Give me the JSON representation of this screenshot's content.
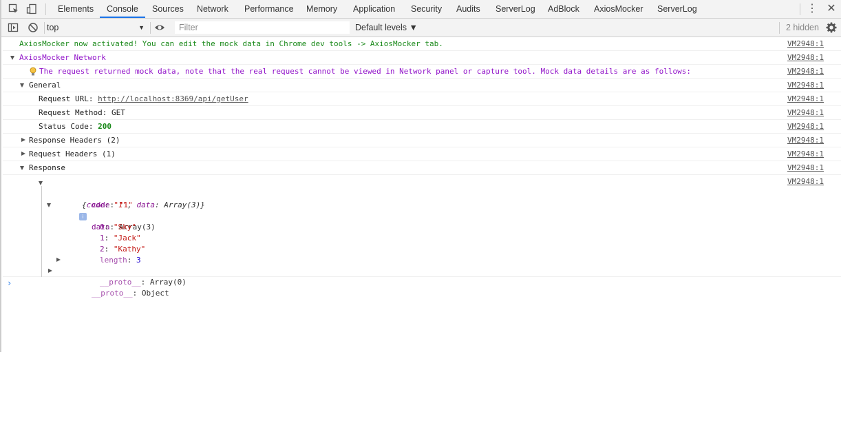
{
  "tabs": [
    "Elements",
    "Console",
    "Sources",
    "Network",
    "Performance",
    "Memory",
    "Application",
    "Security",
    "Audits",
    "ServerLog",
    "AdBlock",
    "AxiosMocker",
    "ServerLog"
  ],
  "active_tab": "Console",
  "toolbar": {
    "context": "top",
    "filter_placeholder": "Filter",
    "levels": "Default levels ▼",
    "hidden": "2 hidden"
  },
  "console": {
    "source": "VM2948:1",
    "activated_msg": "AxiosMocker now activated! You can edit the mock data in Chrome dev tools -> AxiosMocker tab.",
    "network_group": "AxiosMocker Network",
    "tip": "The request returned mock data, note that the real request cannot be viewed in Network panel or capture tool. Mock data details are as follows:",
    "general_label": "General",
    "req_url_label": "Request URL: ",
    "req_url": "http://localhost:8369/api/getUser",
    "req_method_label": "Request Method: ",
    "req_method": "GET",
    "status_label": "Status Code: ",
    "status_code": "200",
    "resp_headers": "Response Headers (2)",
    "req_headers": "Request Headers (1)",
    "response_label": "Response",
    "obj_summary_open": "{",
    "obj_summary_code_key": "code",
    "obj_summary_code_val": "\"1\"",
    "obj_summary_data_key": "data",
    "obj_summary_data_val": "Array(3)",
    "obj_summary_close": "}",
    "code_key": "code",
    "code_val": "\"1\"",
    "data_key": "data",
    "data_type": "Array(3)",
    "items": [
      {
        "k": "0",
        "v": "\"Sky\""
      },
      {
        "k": "1",
        "v": "\"Jack\""
      },
      {
        "k": "2",
        "v": "\"Kathy\""
      }
    ],
    "length_key": "length",
    "length_val": "3",
    "arr_proto_key": "__proto__",
    "arr_proto_val": "Array(0)",
    "obj_proto_key": "__proto__",
    "obj_proto_val": "Object",
    "prompt": "›"
  },
  "colors": {
    "accent": "#1a73e8",
    "green_msg": "#1b8a1b",
    "purple_msg": "#9113c9"
  }
}
